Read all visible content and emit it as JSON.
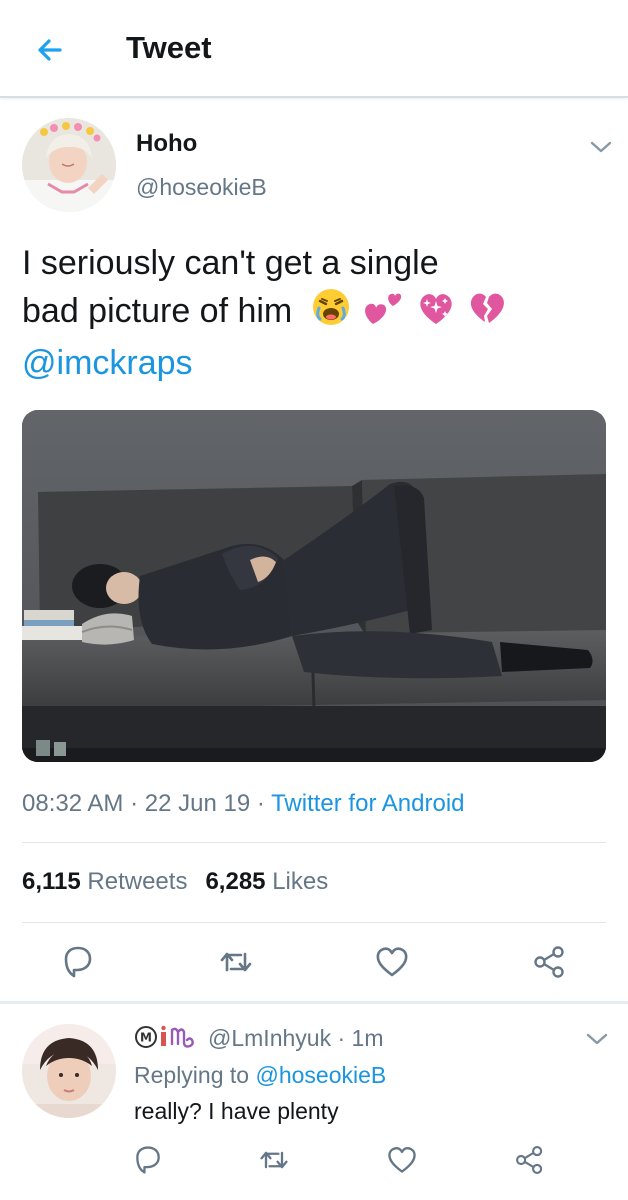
{
  "header": {
    "title": "Tweet"
  },
  "tweet": {
    "author_name": "Hoho",
    "author_handle": "@hoseokieB",
    "text_line1": "I seriously can't get a single",
    "text_line2": "bad picture of him",
    "mention": "@imckraps",
    "emojis": [
      "tired-face-emoji",
      "two-hearts-emoji",
      "sparkling-heart-emoji",
      "broken-heart-emoji"
    ],
    "time": "08:32 AM",
    "date": "22 Jun 19",
    "separator": "·",
    "source": "Twitter for Android",
    "retweets_count": "6,115",
    "retweets_label": "Retweets",
    "likes_count": "6,285",
    "likes_label": "Likes"
  },
  "actions": [
    "reply-icon",
    "retweet-icon",
    "like-icon",
    "share-icon"
  ],
  "reply": {
    "handle": "@LmInhyuk",
    "separator": "·",
    "time": "1m",
    "replying_prefix": "Replying to",
    "replying_to": "@hoseokieB",
    "text": "really? I have plenty"
  },
  "colors": {
    "accent": "#1b95e0",
    "secondary_text": "#657786",
    "primary_text": "#14171a",
    "emoji_heart": "#e0569f"
  }
}
